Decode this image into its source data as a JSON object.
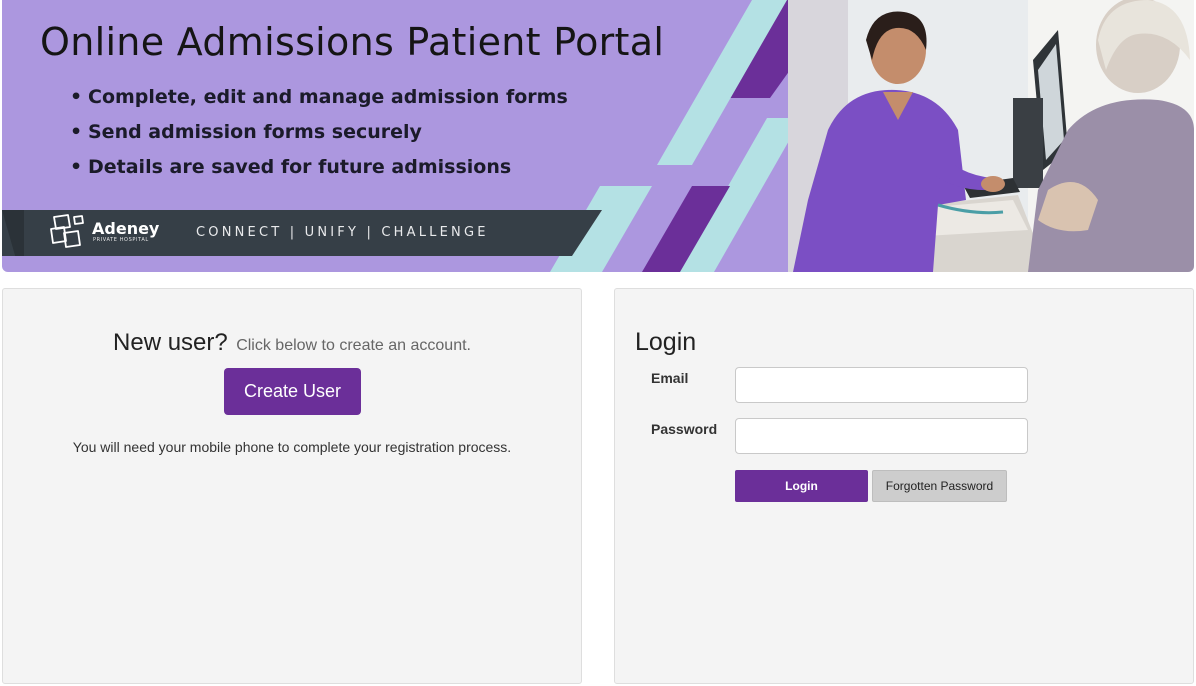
{
  "banner": {
    "title": "Online Admissions Patient Portal",
    "bullets": [
      "Complete, edit and manage admission forms",
      "Send admission forms securely",
      "Details are saved for future admissions"
    ],
    "brand_name": "Adeney",
    "brand_sub": "PRIVATE HOSPITAL",
    "tagline": "CONNECT | UNIFY | CHALLENGE",
    "colors": {
      "lavender": "#ac97df",
      "purple": "#6b2f99",
      "teal": "#b4e1e4",
      "bar": "#363f47"
    }
  },
  "new_user": {
    "heading": "New user?",
    "hint": "Click below to create an account.",
    "button_label": "Create User",
    "note": "You will need your mobile phone to complete your registration process."
  },
  "login": {
    "title": "Login",
    "email_label": "Email",
    "email_value": "",
    "password_label": "Password",
    "password_value": "",
    "login_button": "Login",
    "forgot_button": "Forgotten Password"
  }
}
